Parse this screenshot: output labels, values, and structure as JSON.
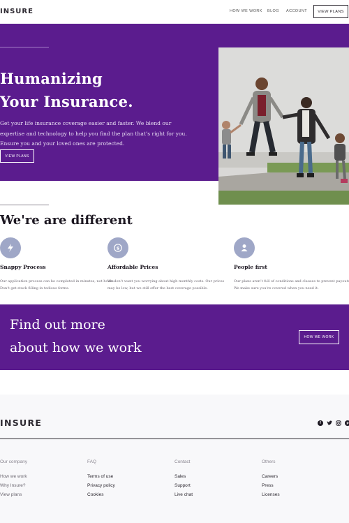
{
  "header": {
    "logo": "INSURE",
    "nav": [
      "HOW WE WORK",
      "BLOG",
      "ACCOUNT"
    ],
    "cta_label": "VIEW PLANS"
  },
  "hero": {
    "title_line1": "Humanizing",
    "title_line2": "Your Insurance.",
    "text": "Get your life insurance coverage easier and faster. We blend our expertise and technology to help you find the plan that’s right for you. Ensure you and your loved ones are protected.",
    "button_label": "VIEW PLANS"
  },
  "different": {
    "title": "We're are different",
    "features": [
      {
        "icon": "lightning-icon",
        "title": "Snappy Process",
        "text": "Our application process can be completed in minutes, not hours. Don’t get stuck filling in tedious forms."
      },
      {
        "icon": "dollar-icon",
        "title": "Affordable Prices",
        "text": "We don’t want you worrying about high monthly costs. Our prices may be low, but we still offer the best coverage possible."
      },
      {
        "icon": "person-icon",
        "title": "People first",
        "text": "Our plans aren’t full of conditions and clauses to prevent payouts. We make sure you’re covered when you need it."
      }
    ]
  },
  "cta": {
    "title_line1": "Find out more",
    "title_line2": "about how we work",
    "button_label": "HOW WE WORK"
  },
  "footer": {
    "logo": "INSURE",
    "socials": [
      "facebook-icon",
      "twitter-icon",
      "instagram-icon",
      "pinterest-icon"
    ],
    "columns": [
      {
        "title": "Our company",
        "links": [
          "How we work",
          "Why Insure?",
          "View plans"
        ]
      },
      {
        "title": "FAQ",
        "links": [
          "Terms of use",
          "Privacy policy",
          "Cookies"
        ]
      },
      {
        "title": "Contact",
        "links": [
          "Sales",
          "Support",
          "Live chat"
        ]
      },
      {
        "title": "Others",
        "links": [
          "Careers",
          "Press",
          "Licenses"
        ]
      }
    ]
  },
  "colors": {
    "brand_purple": "#5b1c8e",
    "icon_circle": "#9fa7c7",
    "dark": "#2c2830"
  }
}
